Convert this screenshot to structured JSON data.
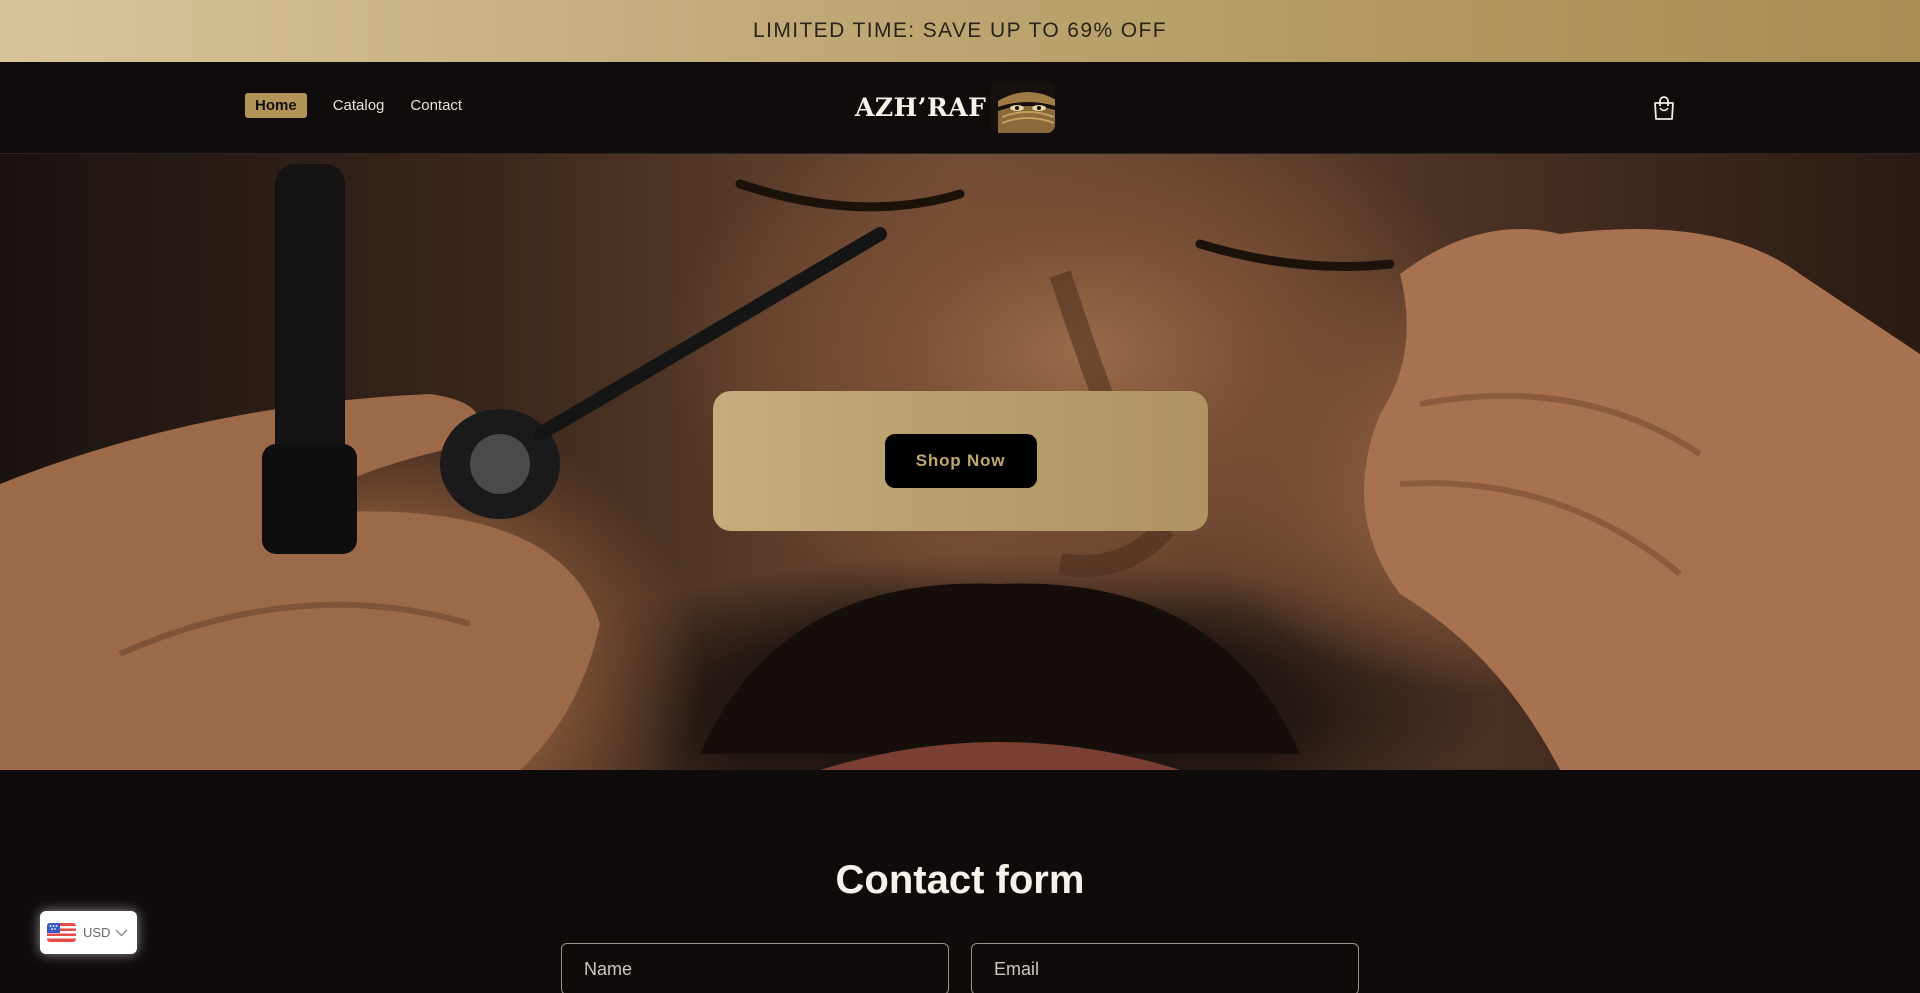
{
  "announcement": {
    "text": "LIMITED TIME: SAVE UP TO 69% OFF"
  },
  "nav": {
    "items": [
      {
        "label": "Home",
        "active": true
      },
      {
        "label": "Catalog",
        "active": false
      },
      {
        "label": "Contact",
        "active": false
      }
    ]
  },
  "brand": {
    "name": "AZH’RAF",
    "logo_icon": "veiled-face-logo-icon"
  },
  "header": {
    "cart_icon": "shopping-bag-icon"
  },
  "hero": {
    "image": "man-applying-kohl-eyeliner-photo",
    "cta_label": "Shop Now"
  },
  "contact": {
    "title": "Contact form",
    "name_placeholder": "Name",
    "email_placeholder": "Email"
  },
  "currency": {
    "code": "USD",
    "flag_icon": "us-flag-icon",
    "chevron_icon": "chevron-down-icon"
  },
  "colors": {
    "announcement_bg": "#c4ad7c",
    "accent_gold": "#b39458",
    "page_bg": "#0f0b0b",
    "cta_bg": "#000000"
  }
}
